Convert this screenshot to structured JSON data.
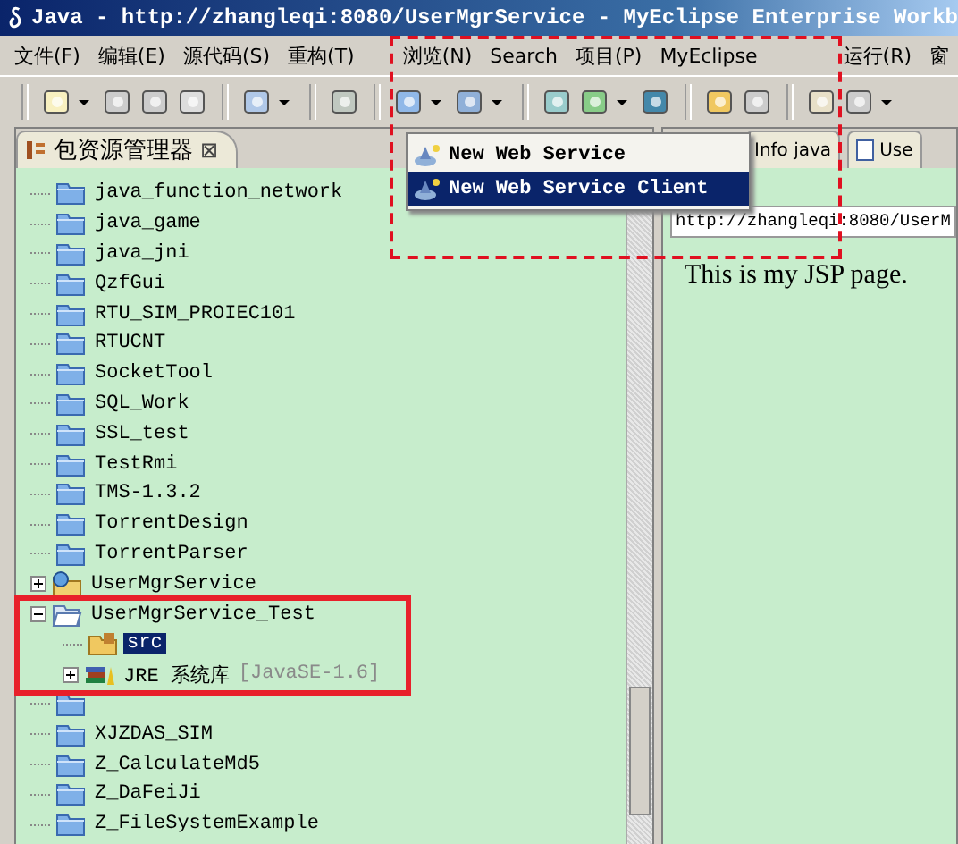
{
  "window": {
    "title": "Java - http://zhangleqi:8080/UserMgrService - MyEclipse Enterprise Workb"
  },
  "menu": [
    "文件(F)",
    "编辑(E)",
    "源代码(S)",
    "重构(T)",
    "浏览(N)",
    "Search",
    "项目(P)",
    "MyEclipse",
    "运行(R)",
    "窗"
  ],
  "popup_menu": {
    "items": [
      {
        "label": "New Web Service",
        "selected": false
      },
      {
        "label": "New Web Service Client",
        "selected": true
      }
    ]
  },
  "package_explorer": {
    "tab": {
      "label": "包资源管理器",
      "close": "⊠"
    },
    "tree": [
      {
        "label": "java_function_network",
        "kind": "folder"
      },
      {
        "label": "java_game",
        "kind": "folder"
      },
      {
        "label": "java_jni",
        "kind": "folder"
      },
      {
        "label": "QzfGui",
        "kind": "folder"
      },
      {
        "label": "RTU_SIM_PROIEC101",
        "kind": "folder"
      },
      {
        "label": "RTUCNT",
        "kind": "folder"
      },
      {
        "label": "SocketTool",
        "kind": "folder"
      },
      {
        "label": "SQL_Work",
        "kind": "folder"
      },
      {
        "label": "SSL_test",
        "kind": "folder"
      },
      {
        "label": "TestRmi",
        "kind": "folder"
      },
      {
        "label": "TMS-1.3.2",
        "kind": "folder"
      },
      {
        "label": "TorrentDesign",
        "kind": "folder"
      },
      {
        "label": "TorrentParser",
        "kind": "folder"
      },
      {
        "label": "UserMgrService",
        "kind": "web-project",
        "expanded": false
      },
      {
        "label": "UserMgrService_Test",
        "kind": "open-project",
        "expanded": true,
        "children": [
          {
            "label": "src",
            "kind": "source-folder",
            "selected": true
          },
          {
            "label": "JRE 系统库",
            "detail": "[JavaSE-1.6]",
            "kind": "library",
            "expanded": false,
            "selected": false
          }
        ]
      },
      {
        "kind": "folder"
      },
      {
        "label": "XJZDAS_SIM",
        "kind": "folder"
      },
      {
        "label": "Z_CalculateMd5",
        "kind": "folder"
      },
      {
        "label": "Z_DaFeiJi",
        "kind": "folder"
      },
      {
        "label": "Z_FileSystemExample",
        "kind": "folder"
      }
    ]
  },
  "editor": {
    "tabs": [
      {
        "label": "Info java",
        "selected": false
      },
      {
        "label": "Use",
        "selected": false
      }
    ],
    "address": "http://zhangleqi:8080/UserM",
    "page_text": "This is my JSP page."
  }
}
